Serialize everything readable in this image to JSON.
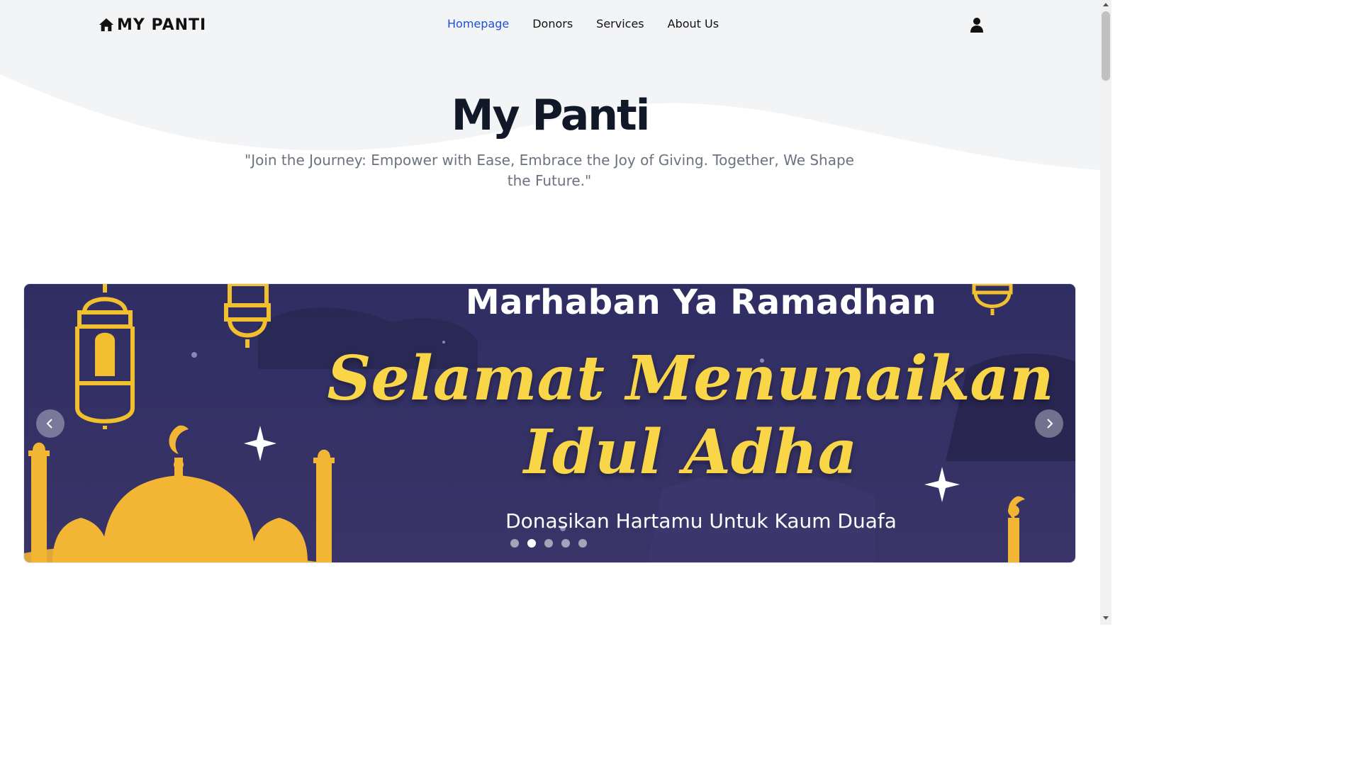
{
  "brand": {
    "name": "MY PANTI",
    "icon": "home-icon"
  },
  "nav": {
    "items": [
      {
        "label": "Homepage",
        "active": true
      },
      {
        "label": "Donors",
        "active": false
      },
      {
        "label": "Services",
        "active": false
      },
      {
        "label": "About Us",
        "active": false
      }
    ],
    "user_icon": "user-icon",
    "active_color": "#1d4ed8"
  },
  "hero": {
    "title": "My Panti",
    "subtitle": "\"Join the Journey: Empower with Ease, Embrace the Joy of Giving. Together, We Shape the Future.\""
  },
  "carousel": {
    "slide": {
      "top_text": "Marhaban Ya Ramadhan",
      "main_text_line1": "Selamat Menunaikan",
      "main_text_line2": "Idul Adha",
      "bottom_text": "Donasikan Hartamu Untuk Kaum Duafa"
    },
    "prev_icon": "chevron-left-icon",
    "next_icon": "chevron-right-icon",
    "indicator_count": 5,
    "active_index": 1,
    "colors": {
      "background": "#2e2d5e",
      "accent": "#f9d548"
    }
  }
}
